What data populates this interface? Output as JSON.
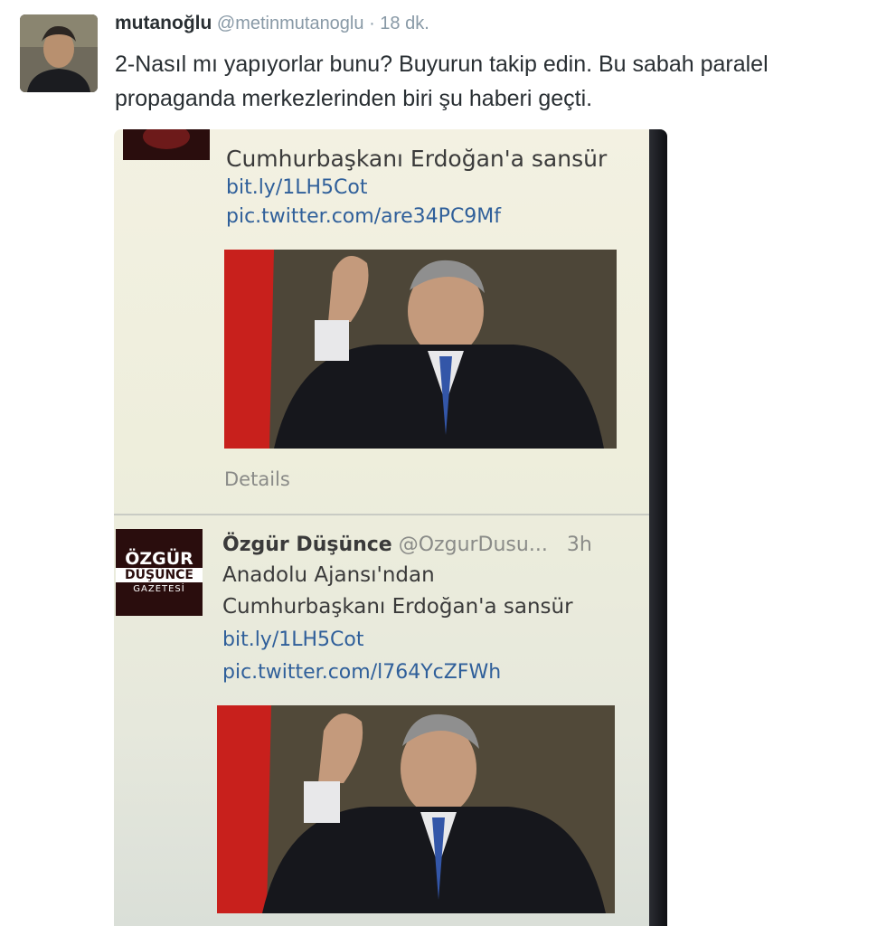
{
  "tweet": {
    "author_name": "mutanoğlu",
    "author_handle": "@metinmutanoglu",
    "separator": "·",
    "time": "18 dk.",
    "text": "2-Nasıl mı yapıyorlar bunu? Buyurun takip edin. Bu sabah paralel propaganda merkezlerinden biri şu haberi geçti."
  },
  "screenshot": {
    "first_tweet": {
      "headline": "Cumhurbaşkanı Erdoğan'a sansür",
      "link": "bit.ly/1LH5Cot",
      "pic": "pic.twitter.com/are34PC9Mf",
      "details": "Details"
    },
    "second_tweet": {
      "name": "Özgür Düşünce",
      "handle": "@OzgurDusu...",
      "time": "3h",
      "line1": "Anadolu Ajansı'ndan",
      "line2": "Cumhurbaşkanı Erdoğan'a sansür",
      "link": "bit.ly/1LH5Cot",
      "pic": "pic.twitter.com/l764YcZFWh",
      "logo_line1": "ÖZGÜR",
      "logo_line2": "DÜŞÜNCE",
      "logo_line3": "GAZETESİ"
    }
  }
}
